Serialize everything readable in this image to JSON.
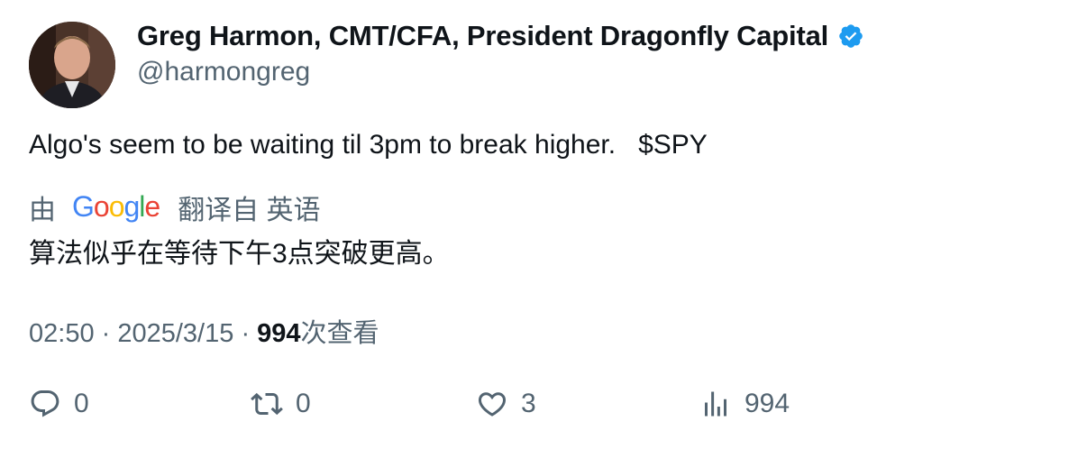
{
  "author": {
    "display_name": "Greg Harmon, CMT/CFA, President Dragonfly Capital",
    "handle": "@harmongreg",
    "verified": true,
    "verified_color": "#1d9bf0"
  },
  "tweet": {
    "text": "Algo's seem to be waiting til 3pm to break higher.   $SPY"
  },
  "translation": {
    "by_label": "由",
    "provider_logo": "Google",
    "translated_from_label": "翻译自 英语",
    "translated_text": "算法似乎在等待下午3点突破更高。"
  },
  "meta": {
    "time": "02:50",
    "separator": "·",
    "date": "2025/3/15",
    "views_count": "994",
    "views_label": "次查看"
  },
  "actions": {
    "reply_count": "0",
    "retweet_count": "0",
    "like_count": "3",
    "views_count": "994"
  },
  "colors": {
    "text_primary": "#0f1419",
    "text_secondary": "#536471"
  }
}
